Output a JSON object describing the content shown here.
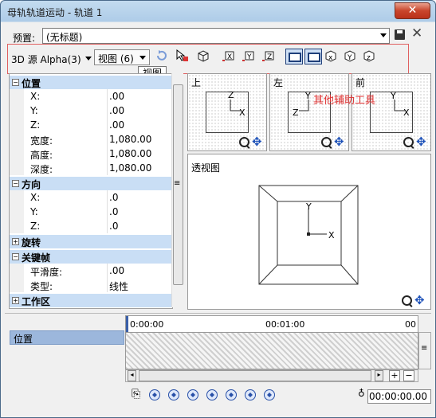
{
  "window": {
    "title": "母轨轨道运动 - 轨道 1",
    "close": "✕"
  },
  "preset": {
    "label": "预置:",
    "value": "(无标题)"
  },
  "toolbar": {
    "source_label": "3D 源 Alpha(3)",
    "view_select": "视图 (6)",
    "tooltip": "视图",
    "annotation": "其他辅助工具"
  },
  "properties": {
    "sections": [
      {
        "title": "位置",
        "expanded": true,
        "rows": [
          {
            "label": "X:",
            "value": ".00"
          },
          {
            "label": "Y:",
            "value": ".00"
          },
          {
            "label": "Z:",
            "value": ".00"
          },
          {
            "label": "宽度:",
            "value": "1,080.00"
          },
          {
            "label": "高度:",
            "value": "1,080.00"
          },
          {
            "label": "深度:",
            "value": "1,080.00"
          }
        ]
      },
      {
        "title": "方向",
        "expanded": true,
        "rows": [
          {
            "label": "X:",
            "value": ".0"
          },
          {
            "label": "Y:",
            "value": ".0"
          },
          {
            "label": "Z:",
            "value": ".0"
          }
        ]
      },
      {
        "title": "旋转",
        "expanded": false,
        "rows": []
      },
      {
        "title": "关键帧",
        "expanded": true,
        "rows": [
          {
            "label": "平滑度:",
            "value": ".00"
          },
          {
            "label": "类型:",
            "value": "线性"
          }
        ]
      },
      {
        "title": "工作区",
        "expanded": false,
        "rows": []
      }
    ]
  },
  "viewports": {
    "top": {
      "label": "上",
      "axis_a": "Z",
      "axis_b": "X"
    },
    "left": {
      "label": "左",
      "axis_a": "Y",
      "axis_b": "Z"
    },
    "front": {
      "label": "前",
      "axis_a": "Y",
      "axis_b": "X"
    },
    "perspective": {
      "label": "透视图",
      "axis_a": "Y",
      "axis_b": "X"
    }
  },
  "timeline": {
    "track": "位置",
    "ruler": [
      "0:00:00",
      "00:01:00",
      "00"
    ],
    "time": "00:00:00.00"
  }
}
